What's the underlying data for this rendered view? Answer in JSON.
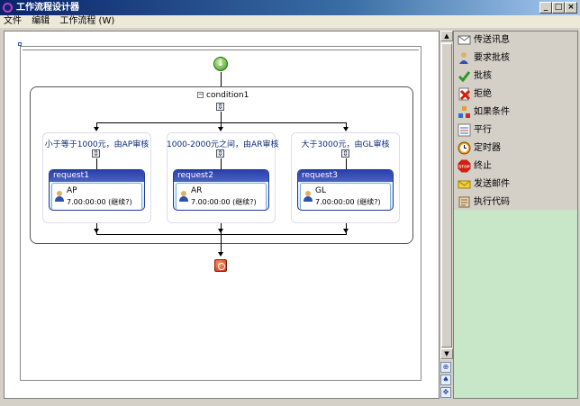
{
  "window": {
    "title": "工作流程设计器",
    "controls": {
      "minimize": "_",
      "maximize": "□",
      "close": "×"
    }
  },
  "menu": [
    "文件",
    "编辑",
    "工作流程 (W)"
  ],
  "designer": {
    "condition": {
      "name": "condition1",
      "collapse_glyph": "−"
    },
    "branches": [
      {
        "title": "小于等于1000元，由AP审核",
        "activity": "request1",
        "role": "AP",
        "time": "7.00:00:00 (继续?)"
      },
      {
        "title": "1000-2000元之间，由AR审核",
        "activity": "request2",
        "role": "AR",
        "time": "7.00:00:00 (继续?)"
      },
      {
        "title": "大于3000元，由GL审核",
        "activity": "request3",
        "role": "GL",
        "time": "7.00:00:00 (继续?)"
      }
    ]
  },
  "toolbox": {
    "items": [
      {
        "label": "传送讯息",
        "icon": "envelope-icon"
      },
      {
        "label": "要求批核",
        "icon": "user-request-icon"
      },
      {
        "label": "批核",
        "icon": "checkmark-icon"
      },
      {
        "label": "拒绝",
        "icon": "reject-icon"
      },
      {
        "label": "如果条件",
        "icon": "condition-icon"
      },
      {
        "label": "平行",
        "icon": "parallel-icon"
      },
      {
        "label": "定时器",
        "icon": "timer-icon"
      },
      {
        "label": "终止",
        "icon": "stop-icon"
      },
      {
        "label": "发送邮件",
        "icon": "mail-icon"
      },
      {
        "label": "执行代码",
        "icon": "code-icon"
      }
    ]
  },
  "colors": {
    "accent": "#0a246a",
    "activity_header": "#2b3fa8",
    "toolbox_bg": "#c8e6c8"
  }
}
